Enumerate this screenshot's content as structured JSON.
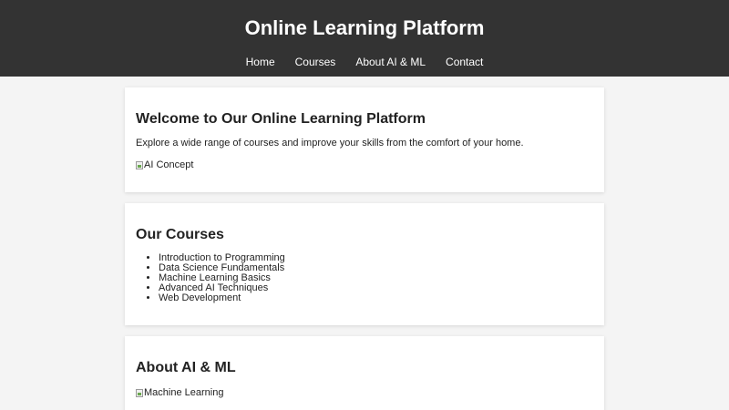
{
  "header": {
    "title": "Online Learning Platform",
    "nav": [
      {
        "label": "Home"
      },
      {
        "label": "Courses"
      },
      {
        "label": "About AI & ML"
      },
      {
        "label": "Contact"
      }
    ]
  },
  "welcome": {
    "heading": "Welcome to Our Online Learning Platform",
    "text": "Explore a wide range of courses and improve your skills from the comfort of your home.",
    "image_alt": "AI Concept"
  },
  "courses": {
    "heading": "Our Courses",
    "items": [
      "Introduction to Programming",
      "Data Science Fundamentals",
      "Machine Learning Basics",
      "Advanced AI Techniques",
      "Web Development"
    ]
  },
  "about": {
    "heading": "About AI & ML",
    "image_alt": "Machine Learning"
  },
  "colors": {
    "header_bg": "#333333",
    "page_bg": "#f4f4f4",
    "card_bg": "#ffffff"
  }
}
